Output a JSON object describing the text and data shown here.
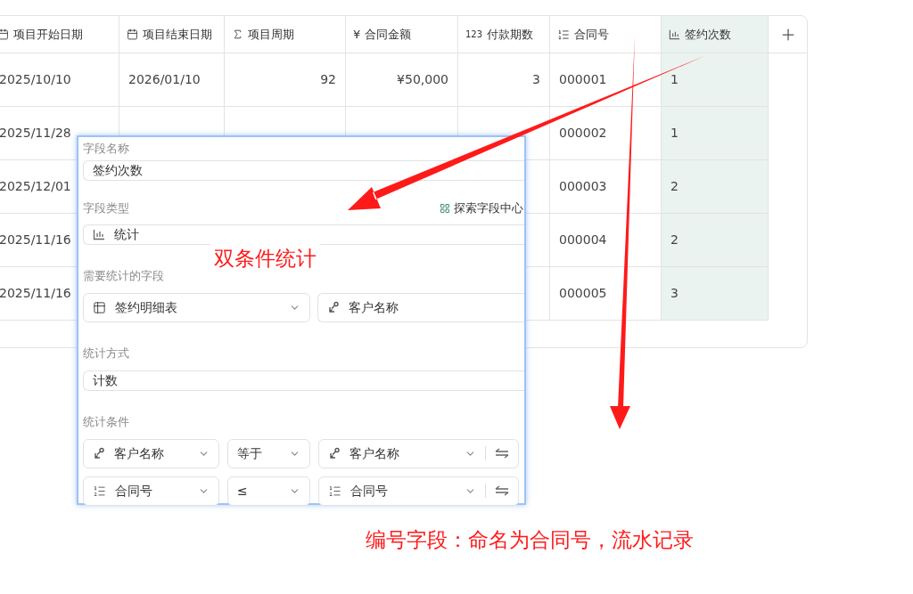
{
  "table": {
    "columns": [
      {
        "label": "项目开始日期",
        "kind": "date",
        "selected": false
      },
      {
        "label": "项目结束日期",
        "kind": "date",
        "selected": false
      },
      {
        "label": "项目周期",
        "kind": "formula",
        "selected": false
      },
      {
        "label": "合同金额",
        "kind": "currency",
        "glyph": "¥",
        "selected": false
      },
      {
        "label": "付款期数",
        "kind": "number",
        "glyph": "123",
        "selected": false
      },
      {
        "label": "合同号",
        "kind": "autonumber",
        "selected": false
      },
      {
        "label": "签约次数",
        "kind": "stat",
        "selected": true
      }
    ],
    "rows": [
      {
        "cells": [
          "2025/10/10",
          "2026/01/10",
          "92",
          "¥50,000",
          "3",
          "000001",
          "1"
        ]
      },
      {
        "cells": [
          "2025/11/28",
          null,
          null,
          null,
          null,
          "000002",
          "1"
        ]
      },
      {
        "cells": [
          "2025/12/01",
          null,
          null,
          null,
          null,
          "000003",
          "2"
        ]
      },
      {
        "cells": [
          "2025/11/16",
          null,
          null,
          null,
          null,
          "000004",
          "2"
        ]
      },
      {
        "cells": [
          "2025/11/16",
          null,
          null,
          null,
          null,
          "000005",
          "3"
        ]
      }
    ]
  },
  "field_dialog": {
    "name_label": "字段名称",
    "name_value": "签约次数",
    "type_label": "字段类型",
    "explore_link": "探索字段中心",
    "type_value": "统计",
    "source_label": "需要统计的字段",
    "source_table": "签约明细表",
    "source_field": "客户名称",
    "method_label": "统计方式",
    "method_value": "计数",
    "conditions_label": "统计条件",
    "conditions": [
      {
        "left": {
          "kind": "link",
          "text": "客户名称"
        },
        "operator": "等于",
        "right": {
          "kind": "link",
          "text": "客户名称"
        }
      },
      {
        "left": {
          "kind": "autonumber",
          "text": "合同号"
        },
        "operator": "≤",
        "right": {
          "kind": "autonumber",
          "text": "合同号"
        }
      }
    ]
  },
  "annotations": [
    {
      "kind": "label",
      "text": "双条件统计"
    },
    {
      "kind": "note",
      "text": "编号字段：命名为合同号，流水记录"
    }
  ]
}
